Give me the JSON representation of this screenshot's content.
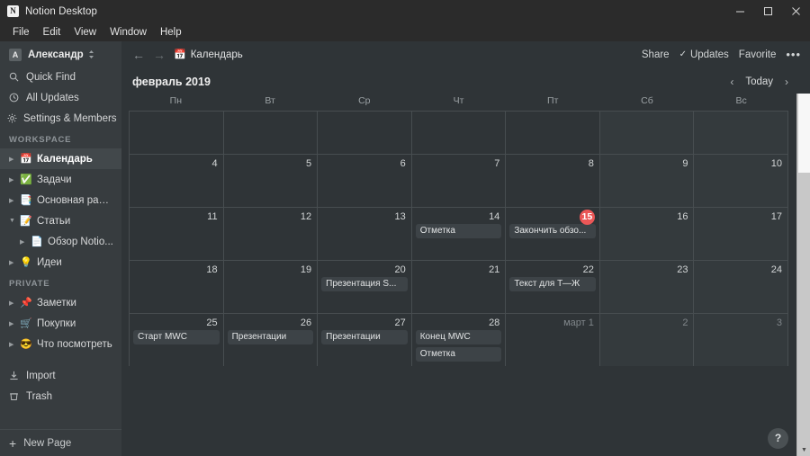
{
  "window": {
    "title": "Notion Desktop",
    "app_icon": "notion-logo-icon",
    "minimize": "─",
    "maximize": "□",
    "close": "✕"
  },
  "menubar": {
    "items": [
      "File",
      "Edit",
      "View",
      "Window",
      "Help"
    ]
  },
  "sidebar": {
    "user": {
      "avatar_letter": "A",
      "name": "Александр",
      "chevron": "⌃⌄"
    },
    "quick_actions": [
      {
        "label": "Quick Find",
        "icon": "search-icon"
      },
      {
        "label": "All Updates",
        "icon": "clock-icon"
      },
      {
        "label": "Settings & Members",
        "icon": "gear-icon"
      }
    ],
    "workspace_section": "WORKSPACE",
    "workspace_items": [
      {
        "label": "Календарь",
        "emoji": "📅",
        "triangle": "▶",
        "active": true,
        "nested": false
      },
      {
        "label": "Задачи",
        "emoji": "✅",
        "triangle": "▶",
        "active": false,
        "nested": false
      },
      {
        "label": "Основная работа",
        "emoji": "📑",
        "triangle": "▶",
        "active": false,
        "nested": false
      },
      {
        "label": "Статьи",
        "emoji": "📝",
        "triangle": "▼",
        "active": false,
        "nested": false
      },
      {
        "label": "Обзор Notio...",
        "emoji": "📄",
        "triangle": "▶",
        "active": false,
        "nested": true
      },
      {
        "label": "Идеи",
        "emoji": "💡",
        "triangle": "▶",
        "active": false,
        "nested": false
      }
    ],
    "private_section": "PRIVATE",
    "private_items": [
      {
        "label": "Заметки",
        "emoji": "📌",
        "triangle": "▶",
        "active": false,
        "nested": false
      },
      {
        "label": "Покупки",
        "emoji": "🛒",
        "triangle": "▶",
        "active": false,
        "nested": false
      },
      {
        "label": "Что посмотреть",
        "emoji": "😎",
        "triangle": "▶",
        "active": false,
        "nested": false
      }
    ],
    "bottom_items": [
      {
        "label": "Import",
        "icon": "import-icon"
      },
      {
        "label": "Trash",
        "icon": "trash-icon"
      }
    ],
    "new_page": {
      "label": "New Page",
      "plus": "+"
    }
  },
  "topbar": {
    "back_arrow": "←",
    "forward_arrow": "→",
    "breadcrumb_emoji": "📅",
    "breadcrumb": "Календарь",
    "share": "Share",
    "updates_check": "✓",
    "updates": "Updates",
    "favorite": "Favorite",
    "more": "•••"
  },
  "calendar": {
    "title": "февраль 2019",
    "prev": "‹",
    "today_label": "Today",
    "next": "›",
    "weekdays": [
      "Пн",
      "Вт",
      "Ср",
      "Чт",
      "Пт",
      "Сб",
      "Вс"
    ],
    "today_day": "15",
    "accent_today": "#eb5757",
    "weeks": [
      [
        {
          "day": "",
          "dim": false,
          "today": false,
          "weekend": false,
          "events": []
        },
        {
          "day": "",
          "dim": false,
          "today": false,
          "weekend": false,
          "events": []
        },
        {
          "day": "",
          "dim": false,
          "today": false,
          "weekend": false,
          "events": []
        },
        {
          "day": "",
          "dim": false,
          "today": false,
          "weekend": false,
          "events": []
        },
        {
          "day": "",
          "dim": false,
          "today": false,
          "weekend": false,
          "events": []
        },
        {
          "day": "",
          "dim": false,
          "today": false,
          "weekend": true,
          "events": []
        },
        {
          "day": "",
          "dim": false,
          "today": false,
          "weekend": true,
          "events": []
        }
      ],
      [
        {
          "day": "4",
          "dim": false,
          "today": false,
          "weekend": false,
          "events": []
        },
        {
          "day": "5",
          "dim": false,
          "today": false,
          "weekend": false,
          "events": []
        },
        {
          "day": "6",
          "dim": false,
          "today": false,
          "weekend": false,
          "events": []
        },
        {
          "day": "7",
          "dim": false,
          "today": false,
          "weekend": false,
          "events": []
        },
        {
          "day": "8",
          "dim": false,
          "today": false,
          "weekend": false,
          "events": []
        },
        {
          "day": "9",
          "dim": false,
          "today": false,
          "weekend": true,
          "events": []
        },
        {
          "day": "10",
          "dim": false,
          "today": false,
          "weekend": true,
          "events": []
        }
      ],
      [
        {
          "day": "11",
          "dim": false,
          "today": false,
          "weekend": false,
          "events": []
        },
        {
          "day": "12",
          "dim": false,
          "today": false,
          "weekend": false,
          "events": []
        },
        {
          "day": "13",
          "dim": false,
          "today": false,
          "weekend": false,
          "events": []
        },
        {
          "day": "14",
          "dim": false,
          "today": false,
          "weekend": false,
          "events": [
            "Отметка"
          ]
        },
        {
          "day": "15",
          "dim": false,
          "today": true,
          "weekend": false,
          "events": [
            "Закончить обзо..."
          ]
        },
        {
          "day": "16",
          "dim": false,
          "today": false,
          "weekend": true,
          "events": []
        },
        {
          "day": "17",
          "dim": false,
          "today": false,
          "weekend": true,
          "events": []
        }
      ],
      [
        {
          "day": "18",
          "dim": false,
          "today": false,
          "weekend": false,
          "events": []
        },
        {
          "day": "19",
          "dim": false,
          "today": false,
          "weekend": false,
          "events": []
        },
        {
          "day": "20",
          "dim": false,
          "today": false,
          "weekend": false,
          "events": [
            "Презентация S..."
          ]
        },
        {
          "day": "21",
          "dim": false,
          "today": false,
          "weekend": false,
          "events": []
        },
        {
          "day": "22",
          "dim": false,
          "today": false,
          "weekend": false,
          "events": [
            "Текст для Т—Ж"
          ]
        },
        {
          "day": "23",
          "dim": false,
          "today": false,
          "weekend": true,
          "events": []
        },
        {
          "day": "24",
          "dim": false,
          "today": false,
          "weekend": true,
          "events": []
        }
      ],
      [
        {
          "day": "25",
          "dim": false,
          "today": false,
          "weekend": false,
          "events": [
            "Старт MWC"
          ]
        },
        {
          "day": "26",
          "dim": false,
          "today": false,
          "weekend": false,
          "events": [
            "Презентации"
          ]
        },
        {
          "day": "27",
          "dim": false,
          "today": false,
          "weekend": false,
          "events": [
            "Презентации"
          ]
        },
        {
          "day": "28",
          "dim": false,
          "today": false,
          "weekend": false,
          "events": [
            "Конец MWC",
            "Отметка"
          ]
        },
        {
          "day": "март 1",
          "dim": true,
          "today": false,
          "weekend": false,
          "events": []
        },
        {
          "day": "2",
          "dim": true,
          "today": false,
          "weekend": true,
          "events": []
        },
        {
          "day": "3",
          "dim": true,
          "today": false,
          "weekend": true,
          "events": []
        }
      ]
    ]
  },
  "help": {
    "label": "?"
  },
  "scrollbar": {
    "up": "▲",
    "down": "▼"
  }
}
